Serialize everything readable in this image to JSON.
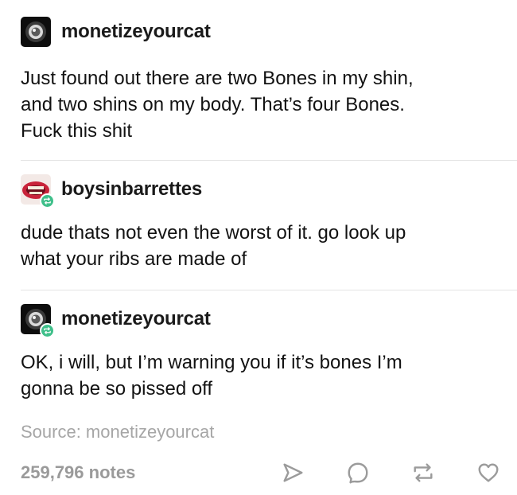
{
  "posts": [
    {
      "username": "monetizeyourcat",
      "avatar": "dark-circle-avatar",
      "reblogged": false,
      "text": "Just found out there are two Bones in my shin,\nand two shins on my body. That’s four Bones.\nFuck this shit"
    },
    {
      "username": "boysinbarrettes",
      "avatar": "mouth-photo-avatar",
      "reblogged": true,
      "text": "dude thats not even the worst of it. go look up\nwhat your ribs are made of"
    },
    {
      "username": "monetizeyourcat",
      "avatar": "dark-circle-avatar",
      "reblogged": true,
      "text": "OK, i will, but I’m warning you if it’s bones I’m\ngonna be so pissed off"
    }
  ],
  "source": "Source: monetizeyourcat",
  "footer": {
    "notes": "259,796 notes",
    "actions": [
      "share-icon",
      "reply-icon",
      "reblog-icon",
      "like-icon"
    ]
  },
  "colors": {
    "reblog_badge": "#3fbf8a",
    "muted_text": "#9a9a9a",
    "icon_stroke": "#9b9b9b"
  }
}
